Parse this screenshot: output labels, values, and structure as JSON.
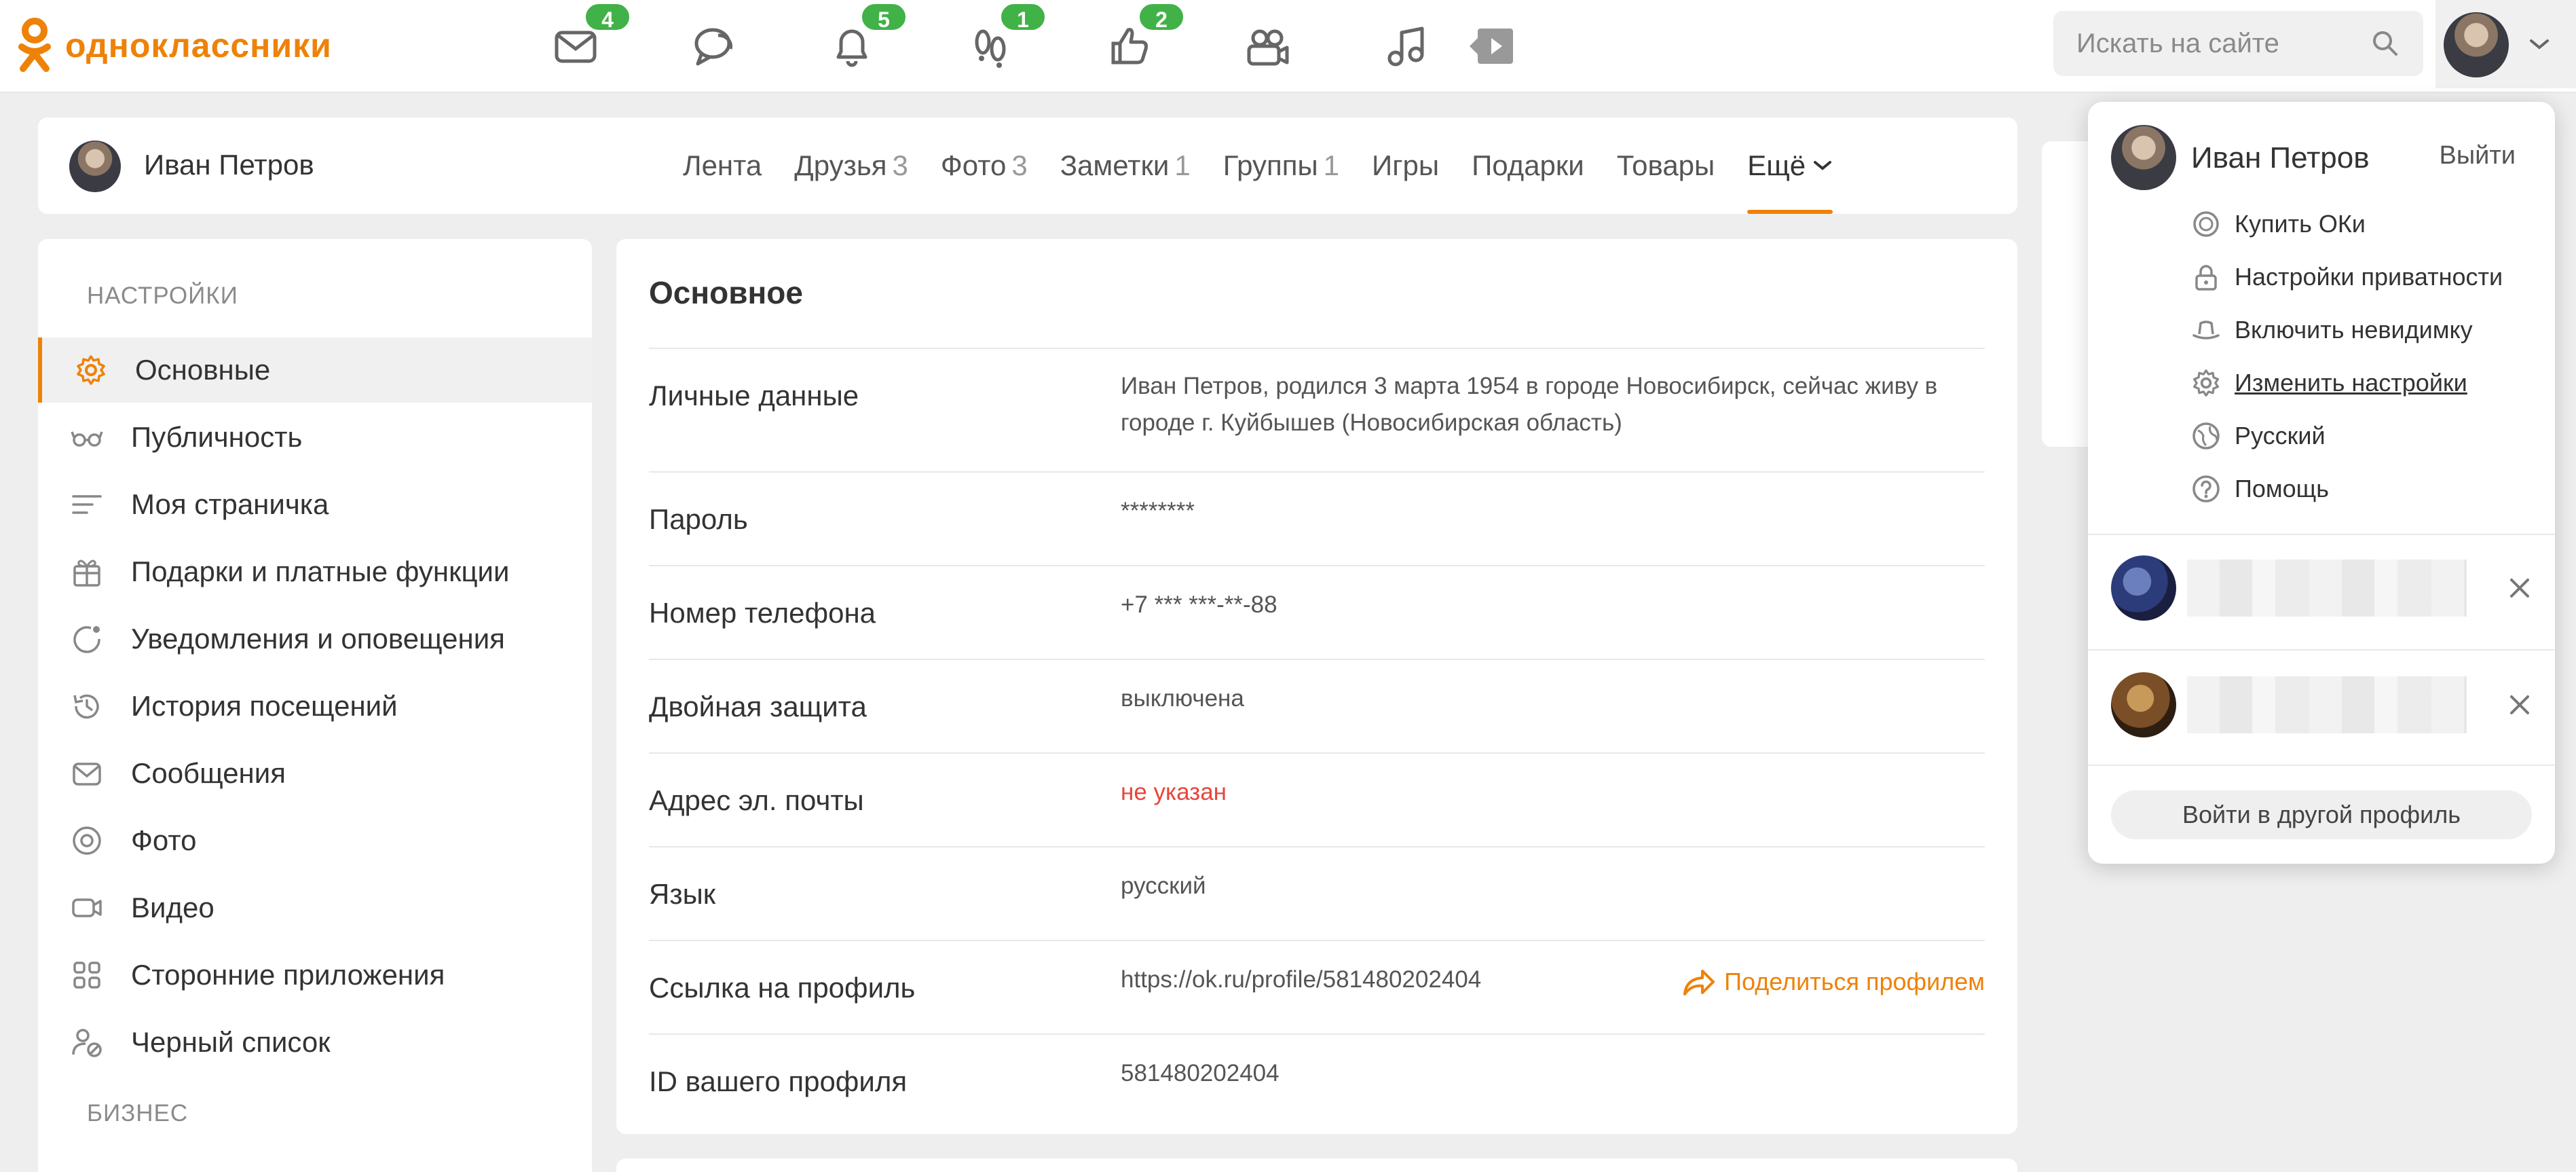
{
  "header": {
    "logo_text": "одноклассники",
    "brand_color": "#ee8208",
    "icons": [
      {
        "name": "messages-icon",
        "badge": "4"
      },
      {
        "name": "discussions-icon",
        "badge": ""
      },
      {
        "name": "notifications-icon",
        "badge": "5"
      },
      {
        "name": "guests-icon",
        "badge": "1"
      },
      {
        "name": "likes-icon",
        "badge": "2"
      },
      {
        "name": "friends-icon",
        "badge": ""
      },
      {
        "name": "music-icon",
        "badge": ""
      },
      {
        "name": "video-icon",
        "badge": ""
      }
    ],
    "badge_color": "#41b247",
    "search_placeholder": "Искать на сайте"
  },
  "profile_nav": {
    "name": "Иван Петров",
    "tabs": [
      {
        "label": "Лента",
        "count": ""
      },
      {
        "label": "Друзья",
        "count": "3"
      },
      {
        "label": "Фото",
        "count": "3"
      },
      {
        "label": "Заметки",
        "count": "1"
      },
      {
        "label": "Группы",
        "count": "1"
      },
      {
        "label": "Игры",
        "count": ""
      },
      {
        "label": "Подарки",
        "count": ""
      },
      {
        "label": "Товары",
        "count": ""
      },
      {
        "label": "Ещё",
        "count": ""
      }
    ]
  },
  "sidebar": {
    "section_settings": "НАСТРОЙКИ",
    "items": [
      {
        "label": "Основные",
        "icon": "gear-icon"
      },
      {
        "label": "Публичность",
        "icon": "glasses-icon"
      },
      {
        "label": "Моя страничка",
        "icon": "lines-icon"
      },
      {
        "label": "Подарки и платные функции",
        "icon": "gift-icon"
      },
      {
        "label": "Уведомления и оповещения",
        "icon": "notification-icon"
      },
      {
        "label": "История посещений",
        "icon": "history-icon"
      },
      {
        "label": "Сообщения",
        "icon": "envelope-icon"
      },
      {
        "label": "Фото",
        "icon": "camera-icon"
      },
      {
        "label": "Видео",
        "icon": "video-camera-icon"
      },
      {
        "label": "Сторонние приложения",
        "icon": "apps-icon"
      },
      {
        "label": "Черный список",
        "icon": "blocked-user-icon"
      }
    ],
    "section_business": "БИЗНЕС"
  },
  "main": {
    "title": "Основное",
    "rows": [
      {
        "label": "Личные данные",
        "value": "Иван Петров, родился 3 марта 1954 в городе Новосибирск, сейчас живу в",
        "value2": "городе г. Куйбышев (Новосибирская область)"
      },
      {
        "label": "Пароль",
        "value": "********"
      },
      {
        "label": "Номер телефона",
        "value": "+7 *** ***-**-88"
      },
      {
        "label": "Двойная защита",
        "value": "выключена"
      },
      {
        "label": "Адрес эл. почты",
        "value": "не указан"
      },
      {
        "label": "Язык",
        "value": "русский"
      },
      {
        "label": "Ссылка на профиль",
        "value": "https://ok.ru/profile/581480202404"
      },
      {
        "label": "ID вашего профиля",
        "value": "581480202404"
      }
    ],
    "share_label": "Поделиться профилем"
  },
  "dropdown": {
    "name": "Иван Петров",
    "logout": "Выйти",
    "items": [
      {
        "label": "Купить ОКи",
        "icon": "ok-coin-icon"
      },
      {
        "label": "Настройки приватности",
        "icon": "lock-icon"
      },
      {
        "label": "Включить невидимку",
        "icon": "hat-icon"
      },
      {
        "label": "Изменить настройки",
        "icon": "gear-icon"
      },
      {
        "label": "Русский",
        "icon": "globe-icon"
      },
      {
        "label": "Помощь",
        "icon": "help-icon"
      }
    ],
    "other_profile": "Войти в другой профиль"
  }
}
